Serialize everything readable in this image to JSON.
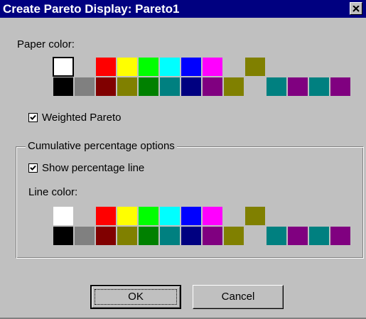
{
  "window": {
    "title": "Create Pareto Display: Pareto1",
    "close_icon": "close-x-icon"
  },
  "paper_color": {
    "label": "Paper color:",
    "selected_index": 0,
    "swatches": [
      "#ffffff",
      "#c0c0c0",
      "#ff0000",
      "#ffff00",
      "#00ff00",
      "#00ffff",
      "#0000ff",
      "#ff00ff",
      "#c0c0c0",
      "#808000",
      "#c0c0c0",
      "#c0c0c0",
      "#c0c0c0",
      "#c0c0c0",
      "#000000",
      "#808080",
      "#800000",
      "#808000",
      "#008000",
      "#008080",
      "#000080",
      "#800080",
      "#808000",
      "#c0c0c0",
      "#008080",
      "#800080",
      "#008080",
      "#800080"
    ]
  },
  "weighted_pareto": {
    "label": "Weighted Pareto",
    "checked": true
  },
  "cumulative": {
    "group_label": "Cumulative percentage options",
    "show_line_label": "Show percentage line",
    "show_line_checked": true,
    "line_color_label": "Line color:",
    "selected_index": -1,
    "swatches": [
      "#ffffff",
      "#c0c0c0",
      "#ff0000",
      "#ffff00",
      "#00ff00",
      "#00ffff",
      "#0000ff",
      "#ff00ff",
      "#c0c0c0",
      "#808000",
      "#c0c0c0",
      "#c0c0c0",
      "#c0c0c0",
      "#c0c0c0",
      "#000000",
      "#808080",
      "#800000",
      "#808000",
      "#008000",
      "#008080",
      "#000080",
      "#800080",
      "#808000",
      "#c0c0c0",
      "#008080",
      "#800080",
      "#008080",
      "#800080"
    ]
  },
  "buttons": {
    "ok_label": "OK",
    "cancel_label": "Cancel"
  },
  "colors": {
    "titlebar": "#000080",
    "dialog_face": "#c0c0c0"
  }
}
